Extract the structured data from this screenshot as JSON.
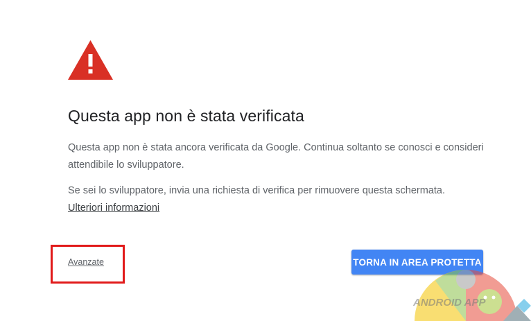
{
  "icon": {
    "name": "warning-icon",
    "color": "#d93025"
  },
  "title": "Questa app non è stata verificata",
  "paragraph_1": "Questa app non è stata ancora verificata da Google. Continua soltanto se conosci e consideri attendibile lo sviluppatore.",
  "paragraph_2": "Se sei lo sviluppatore, invia una richiesta di verifica per rimuovere questa schermata.",
  "learn_more_link": "Ulteriori informazioni",
  "advanced_link": "Avanzate",
  "back_button": "TORNA IN AREA PROTETTA",
  "watermark": {
    "text": "ANDROID APP"
  },
  "colors": {
    "accent": "#4285f4",
    "highlight": "#e11a1a",
    "warning": "#d93025"
  }
}
